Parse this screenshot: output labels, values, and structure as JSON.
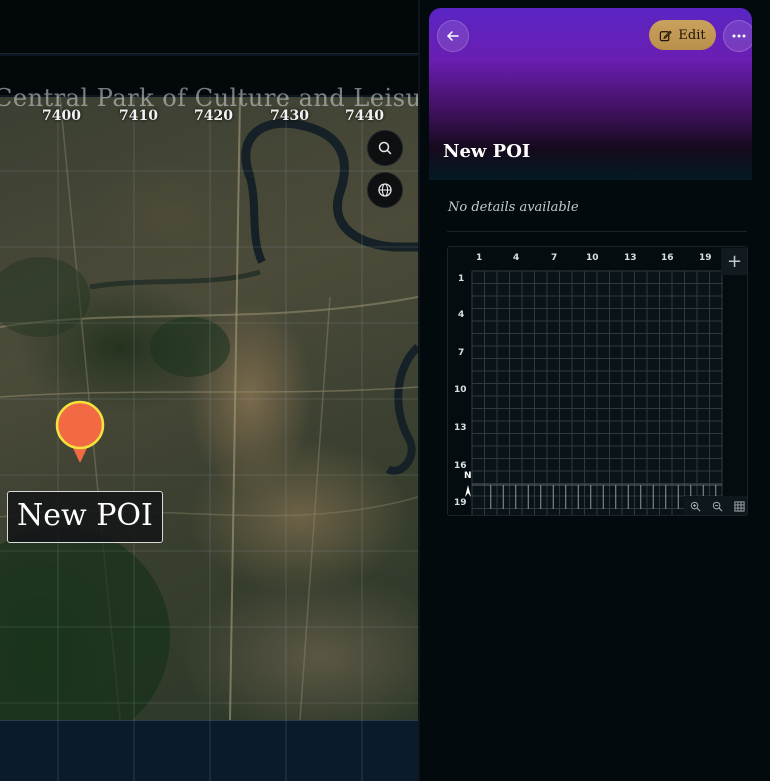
{
  "map": {
    "ghost_title": "Central Park of Culture and Leisure",
    "scale_labels": [
      "7400",
      "7410",
      "7420",
      "7430",
      "7440"
    ],
    "search_icon": "search-icon",
    "globe_icon": "globe-icon",
    "poi": {
      "label": "New POI",
      "pin_color": "#f26a44",
      "pin_border": "#f3e33a"
    }
  },
  "detail": {
    "back_icon": "arrow-left-icon",
    "edit_label": "Edit",
    "edit_icon": "pencil-square-icon",
    "more_icon": "ellipsis-icon",
    "title": "New POI",
    "no_details": "No details available",
    "grid": {
      "col_labels": [
        "1",
        "4",
        "7",
        "10",
        "13",
        "16",
        "19"
      ],
      "row_labels": [
        "1",
        "4",
        "7",
        "10",
        "13",
        "16",
        "19"
      ],
      "north_label": "N",
      "add_label": "+",
      "tools": [
        "zoom-in-icon",
        "zoom-out-icon",
        "grid-icon"
      ]
    }
  },
  "colors": {
    "accent_gold": "#c9a25e",
    "hero_purple": "#5a25c4",
    "pin": "#f26a44"
  }
}
